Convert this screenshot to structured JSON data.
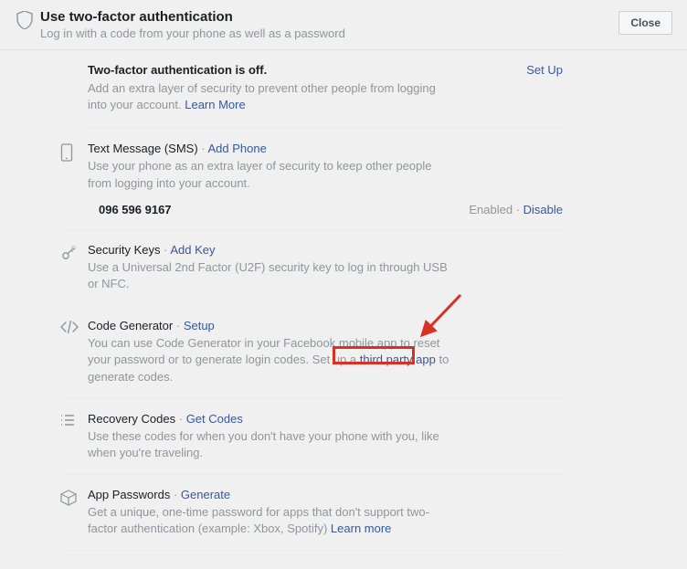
{
  "header": {
    "title": "Use two-factor authentication",
    "subtitle": "Log in with a code from your phone as well as a password",
    "close": "Close"
  },
  "status": {
    "title": "Two-factor authentication is off.",
    "setup": "Set Up",
    "desc": "Add an extra layer of security to prevent other people from logging into your account. ",
    "learn": "Learn More"
  },
  "sms": {
    "title": "Text Message (SMS)",
    "action": "Add Phone",
    "desc": "Use your phone as an extra layer of security to keep other people from logging into your account.",
    "phone": "096 596 9167",
    "enabled": "Enabled",
    "disable": "Disable"
  },
  "keys": {
    "title": "Security Keys",
    "action": "Add Key",
    "desc": "Use a Universal 2nd Factor (U2F) security key to log in through USB or NFC."
  },
  "codegen": {
    "title": "Code Generator",
    "action": "Setup",
    "desc1": "You can use Code Generator in your Facebook mobile app to reset your password or to generate login codes. Set up a ",
    "link": "third party app",
    "desc2": " to generate codes."
  },
  "recovery": {
    "title": "Recovery Codes",
    "action": "Get Codes",
    "desc": "Use these codes for when you don't have your phone with you, like when you're traveling."
  },
  "apppw": {
    "title": "App Passwords",
    "action": "Generate",
    "desc": "Get a unique, one-time password for apps that don't support two-factor authentication (example: Xbox, Spotify) ",
    "learn": "Learn more"
  }
}
